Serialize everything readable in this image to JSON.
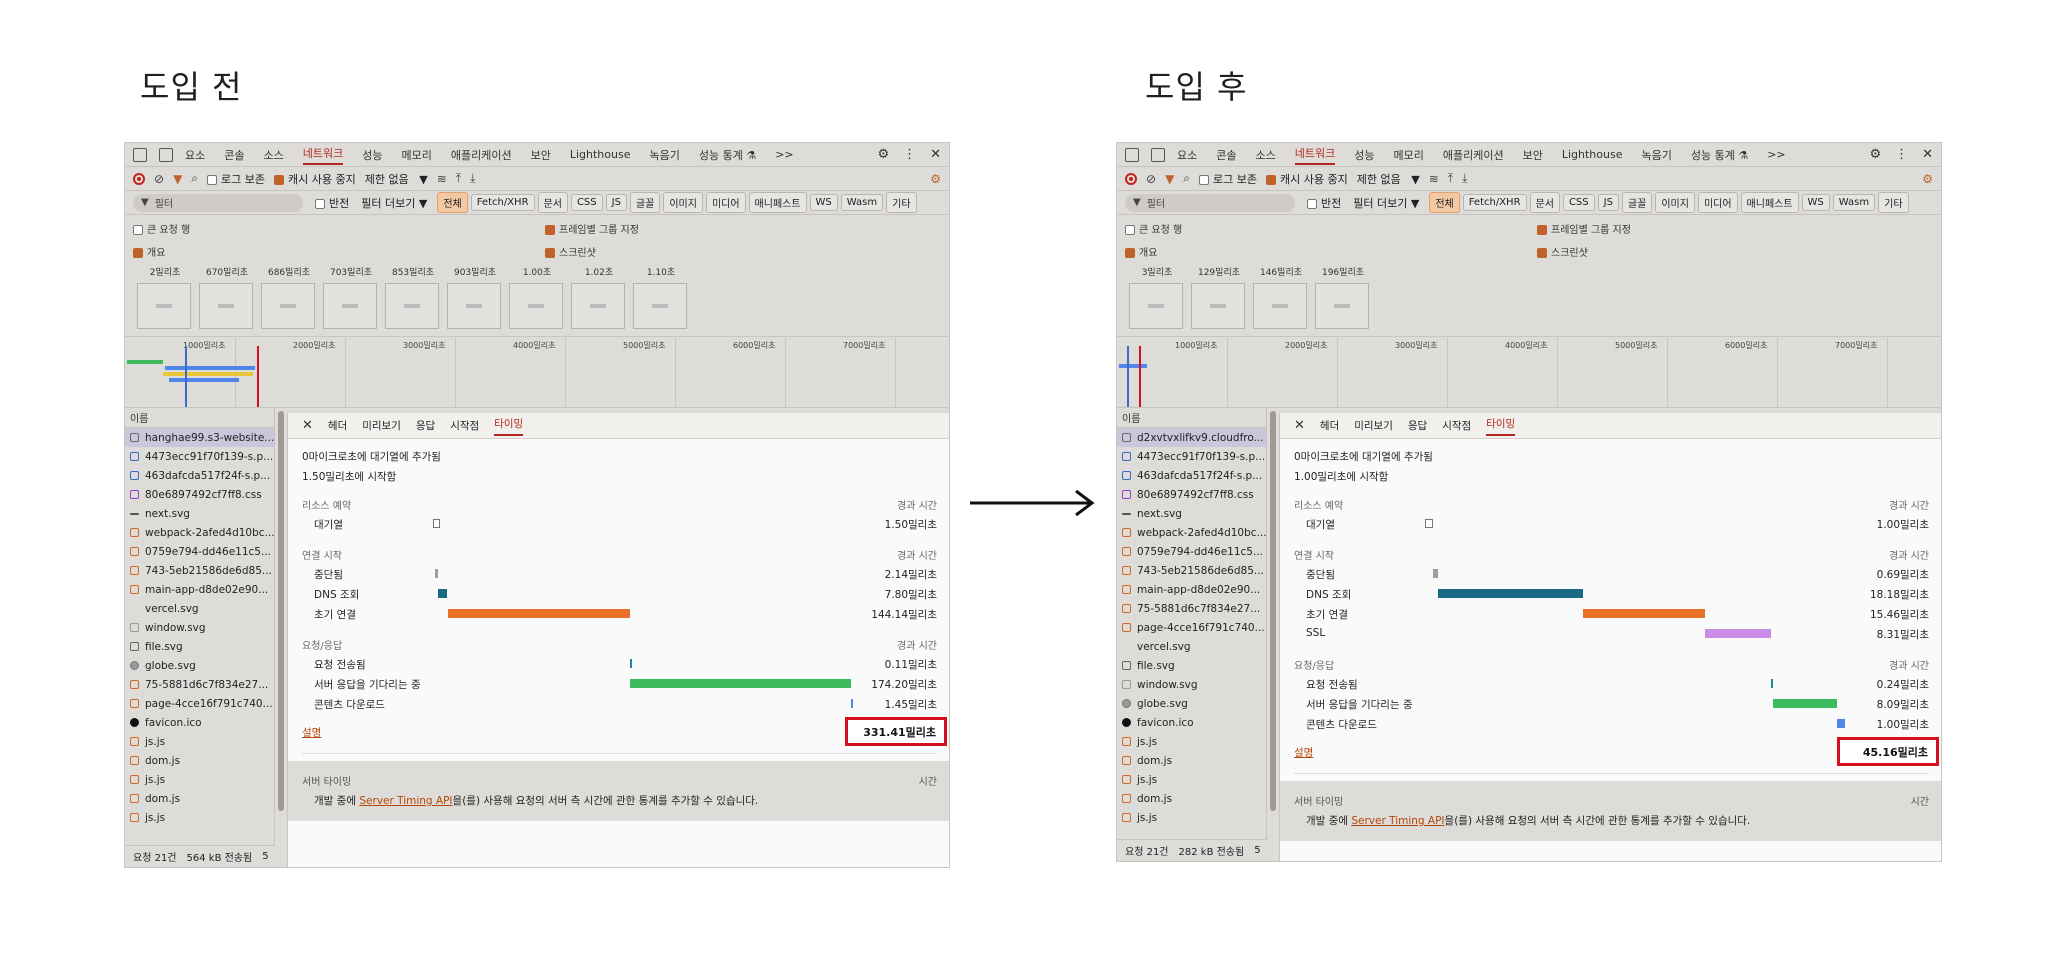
{
  "headings": {
    "before": "도입 전",
    "after": "도입 후"
  },
  "devtools_tabs": [
    "요소",
    "콘솔",
    "소스",
    "네트워크",
    "성능",
    "메모리",
    "애플리케이션",
    "보안",
    "Lighthouse",
    "녹음기",
    "성능 통계 ⚗",
    ">>"
  ],
  "toolbar": {
    "preserve_log": "로그 보존",
    "disable_cache": "캐시 사용 중지",
    "throttle": "제한 없음",
    "throttle_arrow": "▼"
  },
  "filter": {
    "placeholder": "필터",
    "invert": "반전",
    "more_filters": "필터 더보기 ▼",
    "chips": [
      "전체",
      "Fetch/XHR",
      "문서",
      "CSS",
      "JS",
      "글꼴",
      "이미지",
      "미디어",
      "매니페스트",
      "WS",
      "Wasm",
      "기타"
    ]
  },
  "options": {
    "big_rows": "큰 요청 행",
    "group_by_frame": "프레임별 그룹 지정",
    "overview": "개요",
    "screenshots": "스크린샷"
  },
  "ruler_ticks": [
    "1000밀리초",
    "2000밀리초",
    "3000밀리초",
    "4000밀리초",
    "5000밀리초",
    "6000밀리초",
    "7000밀리초"
  ],
  "name_header": "이름",
  "detail_tabs": {
    "close": "✕",
    "headers": "헤더",
    "preview": "미리보기",
    "response": "응답",
    "initiator": "시작점",
    "timing": "타이밍"
  },
  "timing_labels": {
    "resource_scheduling": "리소스 예약",
    "connection_start": "연결 시작",
    "request_response": "요청/응답",
    "duration": "경과 시간",
    "queueing": "대기열",
    "stalled": "중단됨",
    "dns": "DNS 조회",
    "initial_connection": "초기 연결",
    "ssl": "SSL",
    "request_sent": "요청 전송됨",
    "waiting": "서버 응답을 기다리는 중",
    "download": "콘텐츠 다운로드",
    "explanation": "설명",
    "server_timing": "서버 타이밍",
    "time": "시간",
    "server_desc_prefix": "개발 중에 ",
    "server_link": "Server Timing API",
    "server_desc_suffix": "을(를) 사용해 요청의 서버 측 시간에 관한 통계를 추가할 수 있습니다."
  },
  "before": {
    "filmstrip": [
      "2밀리초",
      "670밀리초",
      "686밀리초",
      "703밀리초",
      "853밀리초",
      "903밀리초",
      "1.00초",
      "1.02초",
      "1.10초"
    ],
    "files": [
      {
        "name": "hanghae99.s3-website...",
        "icon": "doc",
        "selected": true
      },
      {
        "name": "4473ecc91f70f139-s.p...",
        "icon": "ts"
      },
      {
        "name": "463dafcda517f24f-s.p...",
        "icon": "ts"
      },
      {
        "name": "80e6897492cf7ff8.css",
        "icon": "css"
      },
      {
        "name": "next.svg",
        "icon": "dash"
      },
      {
        "name": "webpack-2afed4d10bc...",
        "icon": "js"
      },
      {
        "name": "0759e794-dd46e11c5...",
        "icon": "js"
      },
      {
        "name": "743-5eb21586de6d85...",
        "icon": "js"
      },
      {
        "name": "main-app-d8de02e90...",
        "icon": "js"
      },
      {
        "name": "vercel.svg",
        "icon": "none"
      },
      {
        "name": "window.svg",
        "icon": "sv"
      },
      {
        "name": "file.svg",
        "icon": "doc"
      },
      {
        "name": "globe.svg",
        "icon": "circ"
      },
      {
        "name": "75-5881d6c7f834e27...",
        "icon": "js"
      },
      {
        "name": "page-4cce16f791c740...",
        "icon": "js"
      },
      {
        "name": "favicon.ico",
        "icon": "blk"
      },
      {
        "name": "js.js",
        "icon": "js"
      },
      {
        "name": "dom.js",
        "icon": "js"
      },
      {
        "name": "js.js",
        "icon": "js"
      },
      {
        "name": "dom.js",
        "icon": "js"
      },
      {
        "name": "js.js",
        "icon": "js"
      }
    ],
    "status": {
      "requests": "요청 21건",
      "transferred": "564 kB 전송됨",
      "extra": "5"
    },
    "queued_at": "0마이크로초에 대기열에 추가됨",
    "started_at": "1.50밀리초에 시작함",
    "timings": {
      "queueing": "1.50밀리초",
      "stalled": "2.14밀리초",
      "dns": "7.80밀리초",
      "initial_connection": "144.14밀리초",
      "request_sent": "0.11밀리초",
      "waiting": "174.20밀리초",
      "download": "1.45밀리초"
    },
    "total": "331.41밀리초"
  },
  "after": {
    "filmstrip": [
      "3밀리초",
      "129밀리초",
      "146밀리초",
      "196밀리초"
    ],
    "files": [
      {
        "name": "d2xvtvxlifkv9.cloudfro...",
        "icon": "doc",
        "selected": true
      },
      {
        "name": "4473ecc91f70f139-s.p...",
        "icon": "ts"
      },
      {
        "name": "463dafcda517f24f-s.p...",
        "icon": "ts"
      },
      {
        "name": "80e6897492cf7ff8.css",
        "icon": "css"
      },
      {
        "name": "next.svg",
        "icon": "dash"
      },
      {
        "name": "webpack-2afed4d10bc...",
        "icon": "js"
      },
      {
        "name": "0759e794-dd46e11c5...",
        "icon": "js"
      },
      {
        "name": "743-5eb21586de6d85...",
        "icon": "js"
      },
      {
        "name": "main-app-d8de02e90...",
        "icon": "js"
      },
      {
        "name": "75-5881d6c7f834e27...",
        "icon": "js"
      },
      {
        "name": "page-4cce16f791c740...",
        "icon": "js"
      },
      {
        "name": "vercel.svg",
        "icon": "none"
      },
      {
        "name": "file.svg",
        "icon": "doc"
      },
      {
        "name": "window.svg",
        "icon": "sv"
      },
      {
        "name": "globe.svg",
        "icon": "circ"
      },
      {
        "name": "favicon.ico",
        "icon": "blk"
      },
      {
        "name": "js.js",
        "icon": "js"
      },
      {
        "name": "dom.js",
        "icon": "js"
      },
      {
        "name": "js.js",
        "icon": "js"
      },
      {
        "name": "dom.js",
        "icon": "js"
      },
      {
        "name": "js.js",
        "icon": "js"
      }
    ],
    "status": {
      "requests": "요청 21건",
      "transferred": "282 kB 전송됨",
      "extra": "5"
    },
    "queued_at": "0마이크로초에 대기열에 추가됨",
    "started_at": "1.00밀리초에 시작함",
    "timings": {
      "queueing": "1.00밀리초",
      "stalled": "0.69밀리초",
      "dns": "18.18밀리초",
      "initial_connection": "15.46밀리초",
      "ssl": "8.31밀리초",
      "request_sent": "0.24밀리초",
      "waiting": "8.09밀리초",
      "download": "1.00밀리초"
    },
    "total": "45.16밀리초"
  },
  "colors": {
    "dns": "#1b6a85",
    "initial_connection": "#e8712a",
    "ssl": "#c98de8",
    "waiting": "#3cba5e",
    "download": "#4f86e8",
    "highlight": "#d4101e",
    "accent": "#b3261e"
  }
}
